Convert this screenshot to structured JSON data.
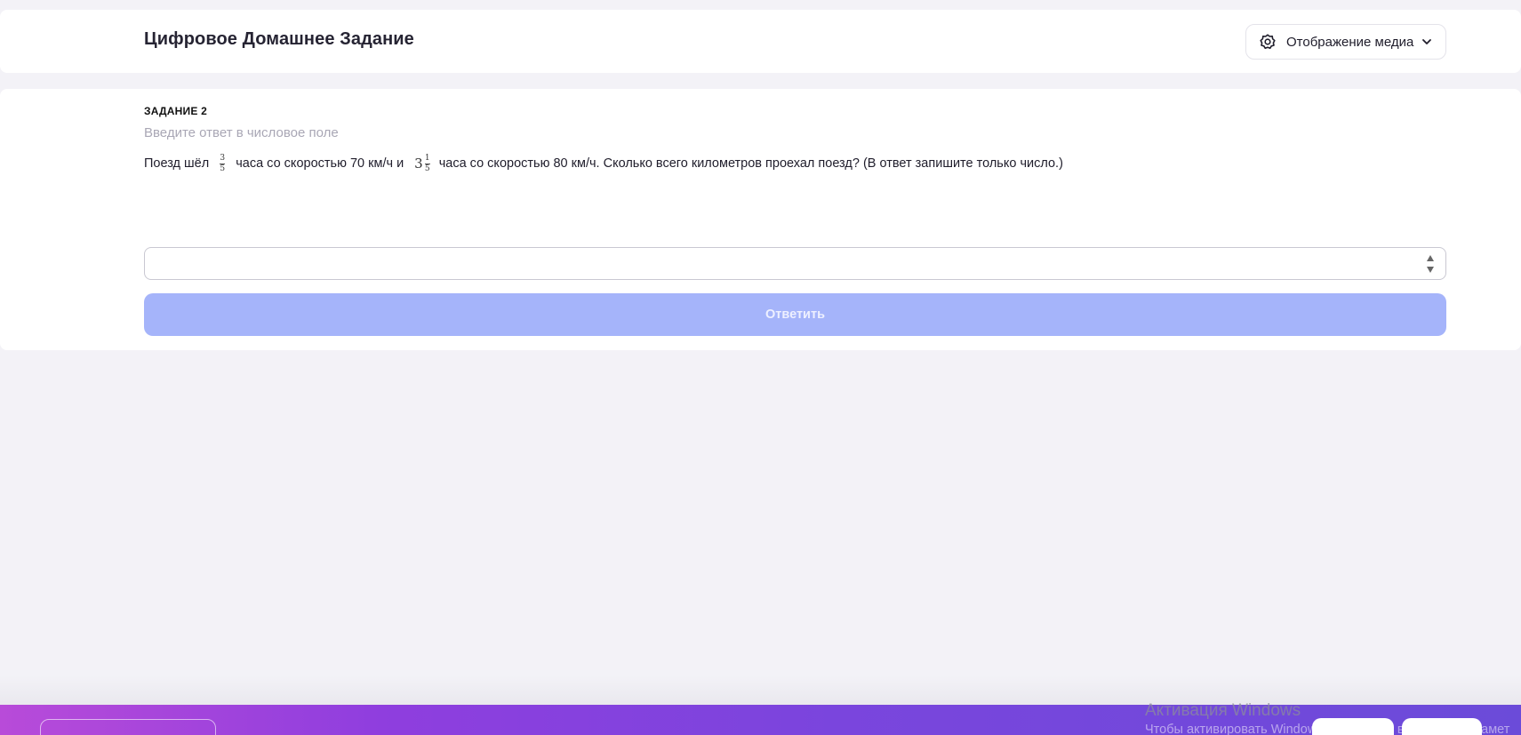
{
  "header": {
    "title": "Цифровое Домашнее Задание",
    "media_button": {
      "label": "Отображение медиа",
      "icon": "gear-icon",
      "chevron": "chevron-down-icon"
    }
  },
  "task": {
    "number_label": "ЗАДАНИЕ 2",
    "hint": "Введите ответ в числовое поле",
    "question": {
      "part1": "Поезд шёл",
      "frac1": {
        "numerator": "3",
        "denominator": "5"
      },
      "part2": "часа со скоростью 70 км/ч и",
      "mixed": {
        "whole": "3",
        "numerator": "1",
        "denominator": "5"
      },
      "part3": "часа со скоростью 80 км/ч. Сколько всего километров проехал поезд? (В ответ запишите только число.)"
    },
    "answer_input": {
      "value": "",
      "placeholder": ""
    },
    "submit_label": "Ответить"
  },
  "colors": {
    "submit_bg": "#a5b4fa",
    "bottom_bar_gradient": [
      "#b84bd9",
      "#6b4bd9"
    ]
  },
  "watermark": {
    "title": "Активация Windows",
    "subtitle": "Чтобы активировать Windows, перейдите в раздел \"Парамет"
  }
}
